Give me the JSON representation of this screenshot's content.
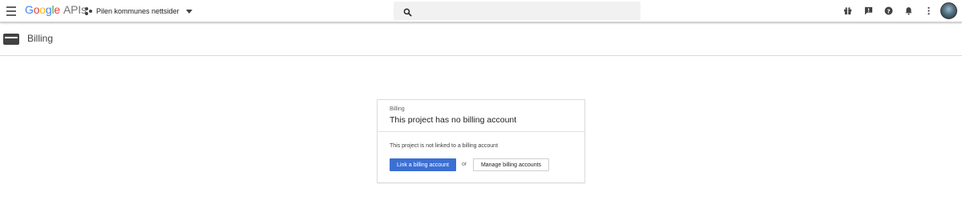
{
  "topbar": {
    "logo": {
      "brand": "Google",
      "product": "APIs"
    },
    "project_name": "Pilen kommunes nettsider",
    "search": {
      "value": "",
      "placeholder": ""
    },
    "icons": [
      "menu-icon",
      "project-dots-icon",
      "dropdown-caret-icon",
      "search-icon",
      "gift-icon",
      "feedback-icon",
      "help-icon",
      "notifications-icon",
      "more-vert-icon"
    ]
  },
  "page": {
    "title": "Billing",
    "icon": "billing-card-icon"
  },
  "card": {
    "eyebrow": "Billing",
    "heading": "This project has no billing account",
    "description": "This project is not linked to a billing account",
    "primary_button": "Link a billing account",
    "or_text": "or",
    "secondary_button": "Manage billing accounts"
  },
  "colors": {
    "primary_button": "#3b6fd4",
    "google_blue": "#4285f4",
    "google_red": "#ea4335",
    "google_yellow": "#fbbc05",
    "google_green": "#34a853"
  }
}
